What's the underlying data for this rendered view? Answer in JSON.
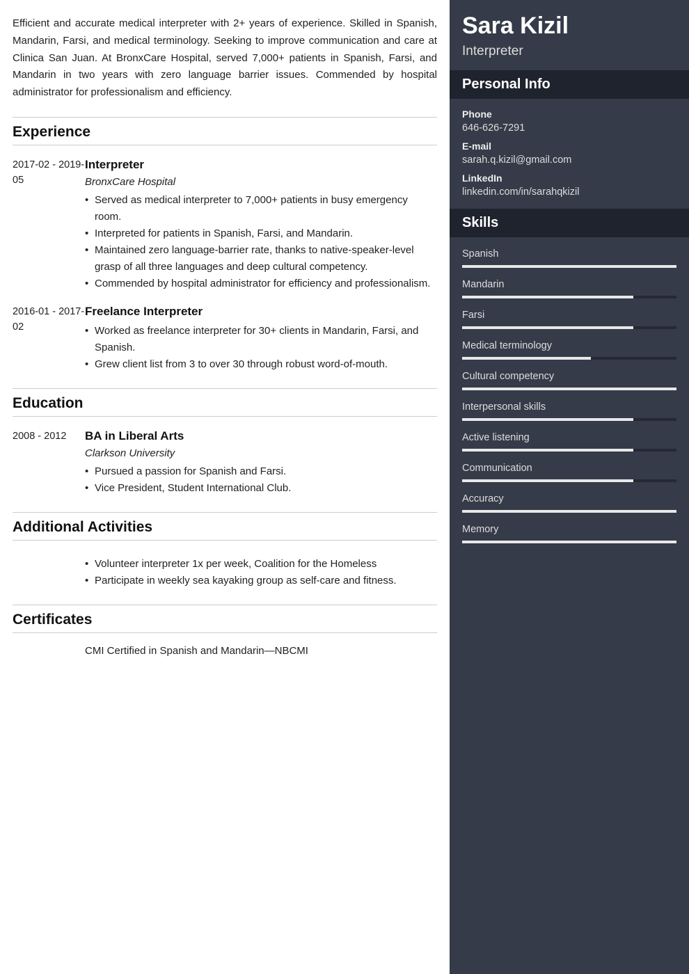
{
  "summary": "Efficient and accurate medical interpreter with 2+ years of experience. Skilled in Spanish, Mandarin, Farsi, and medical terminology. Seeking to improve communication and care at Clinica San Juan. At BronxCare Hospital, served 7,000+ patients in Spanish, Farsi, and Mandarin in two years with zero language barrier issues. Commended by hospital administrator for professionalism and efficiency.",
  "sections": {
    "experience": "Experience",
    "education": "Education",
    "activities": "Additional Activities",
    "certificates": "Certificates"
  },
  "experience": [
    {
      "date": "2017-02 - 2019-05",
      "title": "Interpreter",
      "sub": "BronxCare Hospital",
      "bullets": [
        "Served as medical interpreter to 7,000+ patients in busy emergency room.",
        "Interpreted for patients in Spanish, Farsi, and Mandarin.",
        "Maintained zero language-barrier rate, thanks to native-speaker-level grasp of all three languages and deep cultural competency.",
        "Commended by hospital administrator for efficiency and professionalism."
      ]
    },
    {
      "date": "2016-01 - 2017-02",
      "title": "Freelance Interpreter",
      "sub": "",
      "bullets": [
        "Worked as freelance interpreter for 30+ clients in Mandarin, Farsi, and Spanish.",
        "Grew client list from 3 to over 30 through robust word-of-mouth."
      ]
    }
  ],
  "education": [
    {
      "date": "2008 - 2012",
      "title": "BA in Liberal Arts",
      "sub": "Clarkson University",
      "bullets": [
        "Pursued a passion for Spanish and Farsi.",
        "Vice President, Student International Club."
      ]
    }
  ],
  "activities": {
    "bullets": [
      "Volunteer interpreter 1x per week, Coalition for the Homeless",
      "Participate in weekly sea kayaking group as self-care and fitness."
    ]
  },
  "certificates": {
    "text": "CMI Certified in Spanish and Mandarin—NBCMI"
  },
  "sidebar": {
    "name": "Sara Kizil",
    "role": "Interpreter",
    "personal_info_title": "Personal Info",
    "skills_title": "Skills",
    "info": {
      "phone_label": "Phone",
      "phone": "646-626-7291",
      "email_label": "E-mail",
      "email": "sarah.q.kizil@gmail.com",
      "linkedin_label": "LinkedIn",
      "linkedin": "linkedin.com/in/sarahqkizil"
    },
    "skills": [
      {
        "name": "Spanish",
        "pct": 100
      },
      {
        "name": "Mandarin",
        "pct": 80
      },
      {
        "name": "Farsi",
        "pct": 80
      },
      {
        "name": "Medical terminology",
        "pct": 60
      },
      {
        "name": "Cultural competency",
        "pct": 100
      },
      {
        "name": "Interpersonal skills",
        "pct": 80
      },
      {
        "name": "Active listening",
        "pct": 80
      },
      {
        "name": "Communication",
        "pct": 80
      },
      {
        "name": "Accuracy",
        "pct": 100
      },
      {
        "name": "Memory",
        "pct": 100
      }
    ]
  }
}
